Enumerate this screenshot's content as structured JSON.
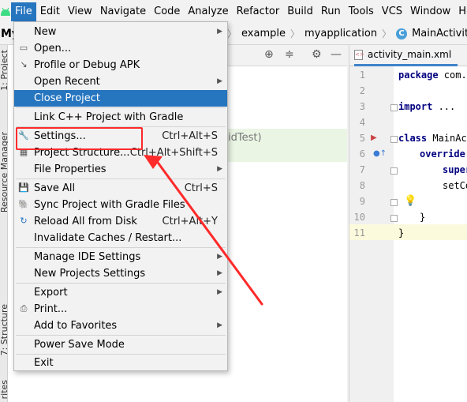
{
  "menubar": {
    "items": [
      "File",
      "Edit",
      "View",
      "Navigate",
      "Code",
      "Analyze",
      "Refactor",
      "Build",
      "Run",
      "Tools",
      "VCS",
      "Window",
      "Help"
    ]
  },
  "navbar": {
    "project": "My",
    "crumbs": [
      "example",
      "myapplication",
      "MainActivity"
    ]
  },
  "left_tabs": [
    "1: Project",
    "Resource Manager",
    "7: Structure",
    "rites"
  ],
  "background_text": "idTest)",
  "file_menu": {
    "items": [
      {
        "label": "New",
        "shortcut": "",
        "submenu": true,
        "icon": ""
      },
      {
        "label": "Open...",
        "shortcut": "",
        "submenu": false,
        "icon": "folder-icon"
      },
      {
        "label": "Profile or Debug APK",
        "shortcut": "",
        "submenu": false,
        "icon": "profile-icon"
      },
      {
        "label": "Open Recent",
        "shortcut": "",
        "submenu": true,
        "icon": ""
      },
      {
        "label": "Close Project",
        "shortcut": "",
        "submenu": false,
        "icon": ""
      },
      {
        "label": "Link C++ Project with Gradle",
        "shortcut": "",
        "submenu": false,
        "icon": ""
      },
      {
        "label": "Settings...",
        "shortcut": "Ctrl+Alt+S",
        "submenu": false,
        "icon": "wrench-icon"
      },
      {
        "label": "Project Structure...",
        "shortcut": "Ctrl+Alt+Shift+S",
        "submenu": false,
        "icon": "project-structure-icon"
      },
      {
        "label": "File Properties",
        "shortcut": "",
        "submenu": true,
        "icon": ""
      },
      {
        "label": "Save All",
        "shortcut": "Ctrl+S",
        "submenu": false,
        "icon": "save-icon"
      },
      {
        "label": "Sync Project with Gradle Files",
        "shortcut": "",
        "submenu": false,
        "icon": "sync-icon"
      },
      {
        "label": "Reload All from Disk",
        "shortcut": "Ctrl+Alt+Y",
        "submenu": false,
        "icon": "reload-icon"
      },
      {
        "label": "Invalidate Caches / Restart...",
        "shortcut": "",
        "submenu": false,
        "icon": ""
      },
      {
        "label": "Manage IDE Settings",
        "shortcut": "",
        "submenu": true,
        "icon": ""
      },
      {
        "label": "New Projects Settings",
        "shortcut": "",
        "submenu": true,
        "icon": ""
      },
      {
        "label": "Export",
        "shortcut": "",
        "submenu": true,
        "icon": ""
      },
      {
        "label": "Print...",
        "shortcut": "",
        "submenu": false,
        "icon": "print-icon"
      },
      {
        "label": "Add to Favorites",
        "shortcut": "",
        "submenu": true,
        "icon": ""
      },
      {
        "label": "Power Save Mode",
        "shortcut": "",
        "submenu": false,
        "icon": ""
      },
      {
        "label": "Exit",
        "shortcut": "",
        "submenu": false,
        "icon": ""
      }
    ],
    "highlighted": "Close Project"
  },
  "editor": {
    "tab": "activity_main.xml",
    "line_numbers": [
      "1",
      "2",
      "3",
      "4",
      "5",
      "6",
      "7",
      "8",
      "9",
      "10",
      "11"
    ],
    "code": {
      "l1_kw": "package",
      "l1_rest": " com.e",
      "l3_kw": "import",
      "l3_rest": " ...",
      "l6_kw": "class",
      "l6_rest": " MainAct",
      "l7_kw": "override",
      "l8": "super",
      "l9": "setCo",
      "l10": "}",
      "l11": "}"
    }
  },
  "colors": {
    "accent": "#2675bf",
    "annotation": "#ff2a2a"
  }
}
